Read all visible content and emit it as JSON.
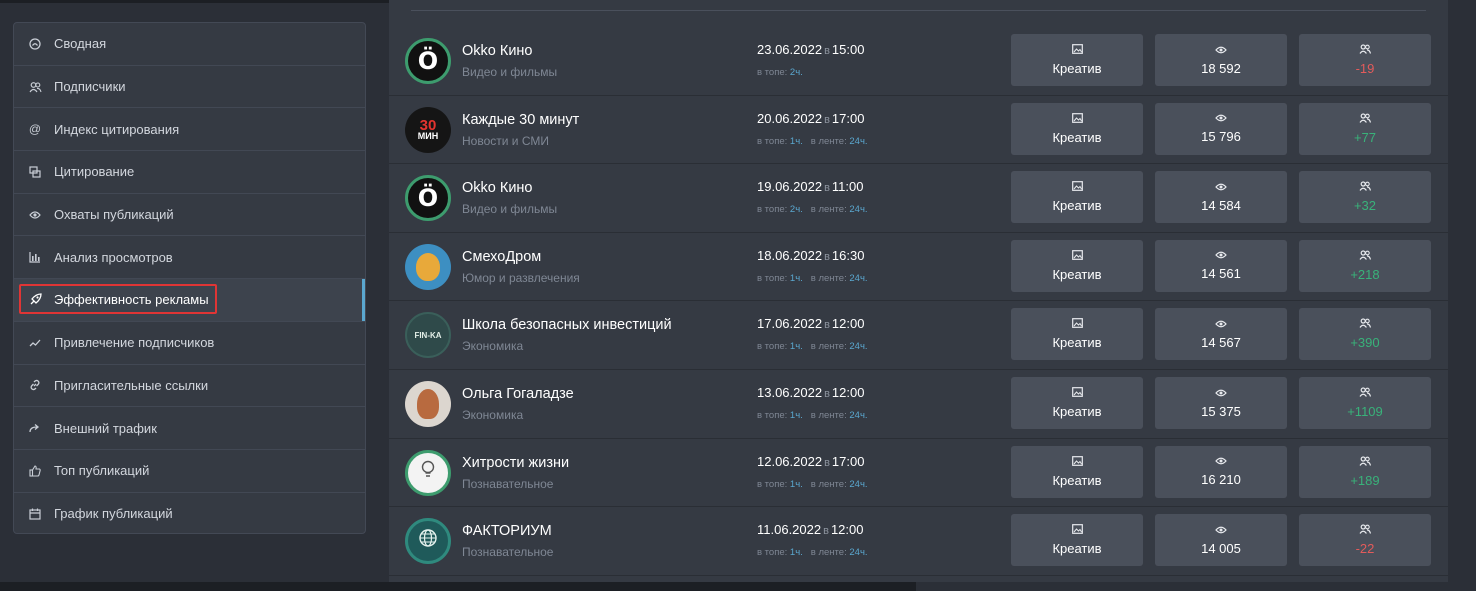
{
  "sidebar": {
    "items": [
      {
        "label": "Сводная",
        "icon": "dashboard-icon"
      },
      {
        "label": "Подписчики",
        "icon": "users-icon"
      },
      {
        "label": "Индекс цитирования",
        "icon": "at-icon"
      },
      {
        "label": "Цитирование",
        "icon": "quote-icon"
      },
      {
        "label": "Охваты публикаций",
        "icon": "eye-icon"
      },
      {
        "label": "Анализ просмотров",
        "icon": "bar-chart-icon"
      },
      {
        "label": "Эффективность рекламы",
        "icon": "rocket-icon",
        "active": true
      },
      {
        "label": "Привлечение подписчиков",
        "icon": "trend-icon"
      },
      {
        "label": "Пригласительные ссылки",
        "icon": "link-icon"
      },
      {
        "label": "Внешний трафик",
        "icon": "share-icon"
      },
      {
        "label": "Топ публикаций",
        "icon": "thumbs-up-icon"
      },
      {
        "label": "График публикаций",
        "icon": "calendar-icon"
      }
    ]
  },
  "labels": {
    "time_sep": "в",
    "in_top": "в топе:",
    "in_feed": "в ленте:",
    "creative": "Креатив"
  },
  "rows": [
    {
      "name": "Okko Кино",
      "category": "Видео и фильмы",
      "date": "23.06.2022",
      "time": "15:00",
      "top": "2ч.",
      "feed": "",
      "views": "18 592",
      "subs": "-19",
      "subs_sign": "neg"
    },
    {
      "name": "Каждые 30 минут",
      "category": "Новости и СМИ",
      "date": "20.06.2022",
      "time": "17:00",
      "top": "1ч.",
      "feed": "24ч.",
      "views": "15 796",
      "subs": "+77",
      "subs_sign": "pos"
    },
    {
      "name": "Okko Кино",
      "category": "Видео и фильмы",
      "date": "19.06.2022",
      "time": "11:00",
      "top": "2ч.",
      "feed": "24ч.",
      "views": "14 584",
      "subs": "+32",
      "subs_sign": "pos"
    },
    {
      "name": "СмехоДром",
      "category": "Юмор и развлечения",
      "date": "18.06.2022",
      "time": "16:30",
      "top": "1ч.",
      "feed": "24ч.",
      "views": "14 561",
      "subs": "+218",
      "subs_sign": "pos"
    },
    {
      "name": "Школа безопасных инвестиций",
      "category": "Экономика",
      "date": "17.06.2022",
      "time": "12:00",
      "top": "1ч.",
      "feed": "24ч.",
      "views": "14 567",
      "subs": "+390",
      "subs_sign": "pos"
    },
    {
      "name": "Ольга Гогаладзе",
      "category": "Экономика",
      "date": "13.06.2022",
      "time": "12:00",
      "top": "1ч.",
      "feed": "24ч.",
      "views": "15 375",
      "subs": "+1109",
      "subs_sign": "pos"
    },
    {
      "name": "Хитрости жизни",
      "category": "Познавательное",
      "date": "12.06.2022",
      "time": "17:00",
      "top": "1ч.",
      "feed": "24ч.",
      "views": "16 210",
      "subs": "+189",
      "subs_sign": "pos"
    },
    {
      "name": "ФАКТОРИУМ",
      "category": "Познавательное",
      "date": "11.06.2022",
      "time": "12:00",
      "top": "1ч.",
      "feed": "24ч.",
      "views": "14 005",
      "subs": "-22",
      "subs_sign": "neg"
    }
  ],
  "avatars": {
    "okko": "Ö",
    "thirty_top": "30",
    "thirty_bottom": "МИН",
    "fin": "FIN-KA"
  },
  "colors": {
    "accent": "#5aa7cf",
    "positive": "#39b27a",
    "negative": "#e35b5b",
    "highlight": "#e03535"
  }
}
